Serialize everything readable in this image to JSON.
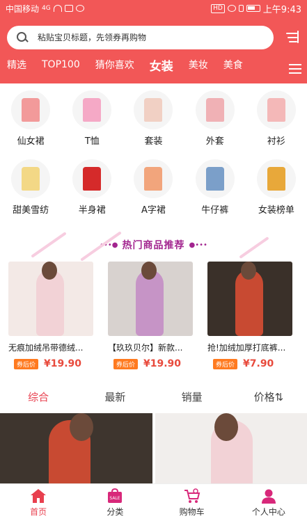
{
  "status_bar": {
    "carrier": "中国移动",
    "signal": "4G",
    "time": "上午9:43",
    "hd": "HD"
  },
  "search": {
    "placeholder": "粘贴宝贝标题，先领券再购物"
  },
  "tabs": [
    {
      "label": "精选",
      "active": false
    },
    {
      "label": "TOP100",
      "active": false
    },
    {
      "label": "猜你喜欢",
      "active": false
    },
    {
      "label": "女装",
      "active": true
    },
    {
      "label": "美妆",
      "active": false
    },
    {
      "label": "美食",
      "active": false
    }
  ],
  "categories": [
    {
      "label": "仙女裙",
      "color": "#f29a9a"
    },
    {
      "label": "T恤",
      "color": "#f5a9c6"
    },
    {
      "label": "套装",
      "color": "#f1d0c4"
    },
    {
      "label": "外套",
      "color": "#f0b1b5"
    },
    {
      "label": "衬衫",
      "color": "#f4b8b8"
    },
    {
      "label": "甜美雪纺",
      "color": "#f3d886"
    },
    {
      "label": "半身裙",
      "color": "#d52a2a"
    },
    {
      "label": "A字裙",
      "color": "#f2a57c"
    },
    {
      "label": "牛仔裤",
      "color": "#7b9fc9"
    },
    {
      "label": "女装榜单",
      "color": "#e8a83a"
    }
  ],
  "hot": {
    "title": "热门商品推荐",
    "dots_left": "•••●",
    "dots_right": "●•••"
  },
  "goods": [
    {
      "title": "无痕加绒吊带德绒...",
      "coupon": "券后价",
      "price": "¥19.90",
      "bg": "#f3e9e6",
      "fg": "#f2d2d6"
    },
    {
      "title": "【玖玖贝尔】新款...",
      "coupon": "券后价",
      "price": "¥19.90",
      "bg": "#d8d2cf",
      "fg": "#c694c6"
    },
    {
      "title": "抢!加绒加厚打底裤...",
      "coupon": "券后价",
      "price": "¥7.90",
      "bg": "#3a3029",
      "fg": "#c84a32"
    }
  ],
  "sort": [
    {
      "label": "综合",
      "active": true
    },
    {
      "label": "最新",
      "active": false
    },
    {
      "label": "销量",
      "active": false
    },
    {
      "label": "价格⇅",
      "active": false
    }
  ],
  "feed": [
    {
      "bg": "#3e352e",
      "fg": "#c84a32"
    },
    {
      "bg": "#f1eeec",
      "fg": "#f2d2d6"
    }
  ],
  "bottom_nav": [
    {
      "label": "首页",
      "icon": "home-icon",
      "active": true
    },
    {
      "label": "分类",
      "icon": "sale-bag-icon",
      "active": false
    },
    {
      "label": "购物车",
      "icon": "cart-icon",
      "active": false
    },
    {
      "label": "个人中心",
      "icon": "person-icon",
      "active": false
    }
  ],
  "colors": {
    "brand_red": "#f25757",
    "accent": "#e8404f",
    "hot_purple": "#a2258f",
    "price": "#e84a3c",
    "coupon": "#ff7a1f"
  }
}
